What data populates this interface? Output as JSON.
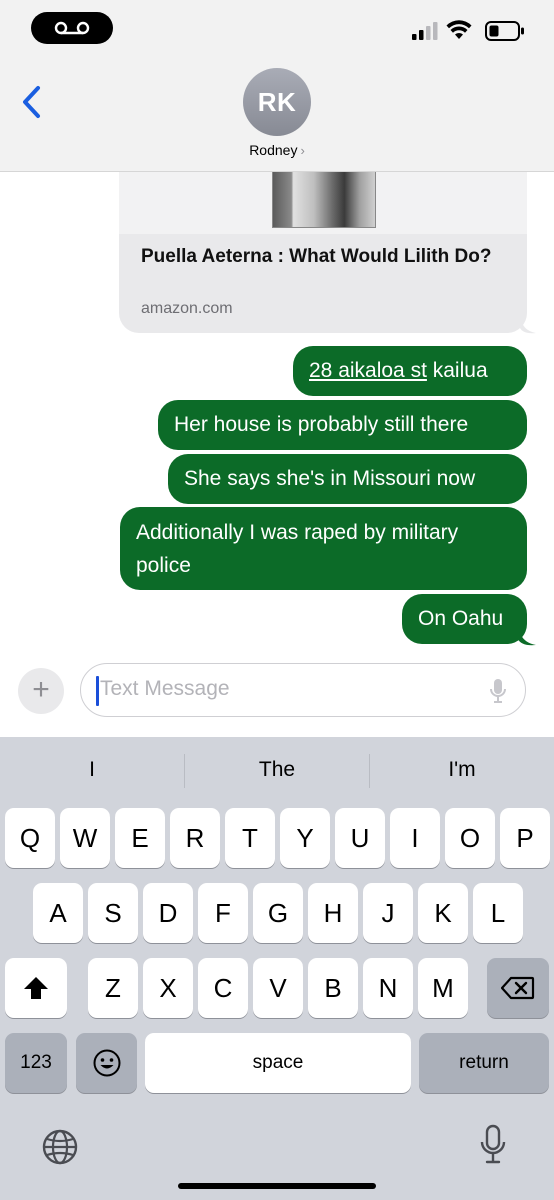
{
  "header": {
    "avatar_initials": "RK",
    "contact_name": "Rodney",
    "contact_chevron": "›"
  },
  "link_preview": {
    "title": "Puella Aeterna : What Would Lilith Do?",
    "domain": "amazon.com"
  },
  "messages": [
    {
      "underlined": "28 aikaloa st",
      "rest": " kailua"
    },
    {
      "text": "Her house is probably still there"
    },
    {
      "text": "She says she's in Missouri now"
    },
    {
      "text": "Additionally I was raped by military police"
    },
    {
      "text": "On Oahu"
    }
  ],
  "composer": {
    "plus_label": "+",
    "placeholder": "Text Message"
  },
  "keyboard": {
    "suggestions": [
      "I",
      "The",
      "I'm"
    ],
    "row1": [
      "Q",
      "W",
      "E",
      "R",
      "T",
      "Y",
      "U",
      "I",
      "O",
      "P"
    ],
    "row2": [
      "A",
      "S",
      "D",
      "F",
      "G",
      "H",
      "J",
      "K",
      "L"
    ],
    "row3": [
      "Z",
      "X",
      "C",
      "V",
      "B",
      "N",
      "M"
    ],
    "numbers_label": "123",
    "space_label": "space",
    "return_label": "return"
  },
  "colors": {
    "sent_bubble": "#0c6b28",
    "received_bubble": "#e9e9eb",
    "accent_blue": "#1a5ee0",
    "keyboard_bg": "#d1d4db"
  },
  "icons": {
    "voicemail": "voicemail-icon",
    "signal": "signal-icon",
    "wifi": "wifi-icon",
    "battery": "battery-icon",
    "back": "chevron-left-icon",
    "mic": "microphone-icon",
    "shift": "shift-icon",
    "delete": "delete-icon",
    "emoji": "emoji-icon",
    "globe": "globe-icon",
    "dictation": "microphone-icon"
  }
}
